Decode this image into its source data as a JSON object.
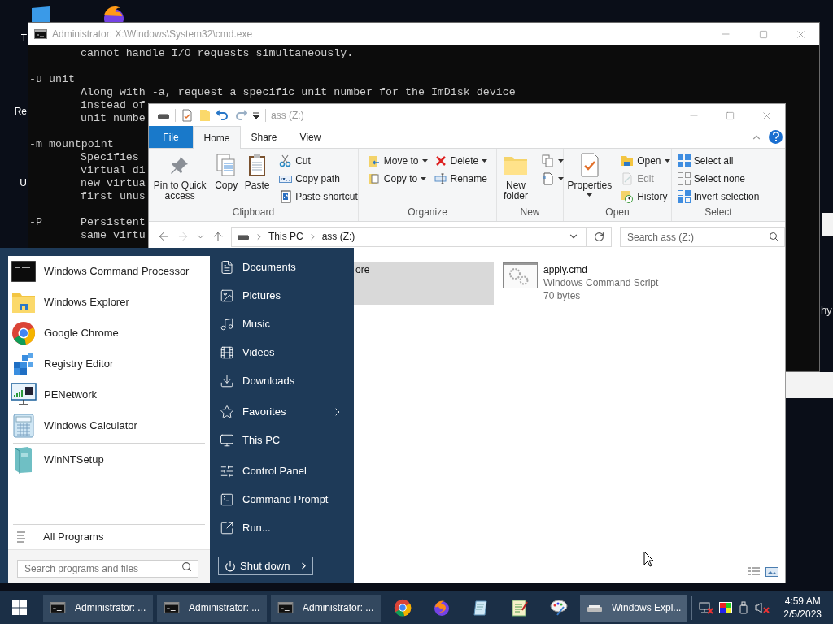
{
  "desktop": {
    "labels": [
      "T",
      "Re",
      "U"
    ]
  },
  "cmd_window": {
    "title": "Administrator: X:\\Windows\\System32\\cmd.exe",
    "blocks": [
      {
        "lines": [
          {
            "text": "cannot handle I/O requests simultaneously."
          }
        ]
      },
      {
        "lines": [
          {
            "flag": "-u unit"
          },
          {
            "text": "Along with -a, request a specific unit number for the ImDisk device"
          },
          {
            "text": "instead of"
          },
          {
            "text": "unit numbe"
          }
        ]
      },
      {
        "lines": [
          {
            "flag": "-m mountpoint"
          },
          {
            "text": "Specifies"
          },
          {
            "text": "virtual di"
          },
          {
            "text": "new virtua"
          },
          {
            "text": "first unus"
          }
        ]
      },
      {
        "lines": [
          {
            "flag": "-P",
            "text": "Persistent"
          },
          {
            "text": "same virtu"
          }
        ]
      }
    ]
  },
  "explorer": {
    "title": "ass (Z:)",
    "tabs": [
      {
        "label": "File",
        "kind": "menu",
        "selected": false
      },
      {
        "label": "Home",
        "kind": "tab",
        "selected": true
      },
      {
        "label": "Share",
        "kind": "tab",
        "selected": false
      },
      {
        "label": "View",
        "kind": "tab",
        "selected": false
      }
    ],
    "ribbon": [
      {
        "label": "Clipboard",
        "columns": [
          {
            "kind": "large",
            "items": [
              {
                "label": "Pin to Quick access",
                "dropdown": false,
                "disabled": false
              },
              {
                "label": "Copy",
                "dropdown": false,
                "disabled": false
              },
              {
                "label": "Paste",
                "dropdown": false,
                "disabled": false
              }
            ]
          },
          {
            "kind": "small",
            "items": [
              {
                "label": "Cut",
                "dropdown": false,
                "disabled": false
              },
              {
                "label": "Copy path",
                "dropdown": false,
                "disabled": false
              },
              {
                "label": "Paste shortcut",
                "dropdown": false,
                "disabled": false
              }
            ]
          }
        ]
      },
      {
        "label": "Organize",
        "columns": [
          {
            "kind": "small",
            "items": [
              {
                "label": "Move to",
                "dropdown": true,
                "disabled": false
              },
              {
                "label": "Copy to",
                "dropdown": true,
                "disabled": false
              }
            ]
          },
          {
            "kind": "small",
            "items": [
              {
                "label": "Delete",
                "dropdown": true,
                "disabled": false
              },
              {
                "label": "Rename",
                "dropdown": false,
                "disabled": false
              }
            ]
          }
        ]
      },
      {
        "label": "New",
        "columns": [
          {
            "kind": "large",
            "items": [
              {
                "label": "New folder",
                "dropdown": false,
                "disabled": false
              }
            ]
          },
          {
            "kind": "small",
            "items": [
              {
                "dropdown": true,
                "disabled": false
              },
              {
                "dropdown": true,
                "disabled": false
              }
            ]
          }
        ]
      },
      {
        "label": "Open",
        "columns": [
          {
            "kind": "large",
            "items": [
              {
                "label": "Properties",
                "dropdown": true,
                "disabled": false
              }
            ]
          },
          {
            "kind": "small",
            "items": [
              {
                "label": "Open",
                "dropdown": true,
                "disabled": false
              },
              {
                "label": "Edit",
                "dropdown": false,
                "disabled": true
              },
              {
                "label": "History",
                "dropdown": false,
                "disabled": false
              }
            ]
          }
        ]
      },
      {
        "label": "Select",
        "columns": [
          {
            "kind": "small",
            "items": [
              {
                "label": "Select all",
                "dropdown": false,
                "disabled": false
              },
              {
                "label": "Select none",
                "dropdown": false,
                "disabled": false
              },
              {
                "label": "Invert selection",
                "dropdown": false,
                "disabled": false
              }
            ]
          }
        ]
      }
    ],
    "back": {
      "disabled": false
    },
    "forward": {
      "disabled": true
    },
    "path": [
      "This PC",
      "ass (Z:)"
    ],
    "search": {
      "placeholder": "Search ass (Z:)"
    },
    "files": [
      {
        "name": "ore",
        "selected": true
      },
      {
        "name": "apply.cmd",
        "type": "Windows Command Script",
        "size": "70 bytes",
        "selected": false
      }
    ]
  },
  "start_menu": {
    "programs": [
      "Windows Command Processor",
      "Windows Explorer",
      "Google Chrome",
      "Registry Editor",
      "PENetwork",
      "Windows Calculator"
    ],
    "recent": [
      "WinNTSetup"
    ],
    "all_programs": "All Programs",
    "search": {
      "placeholder": "Search programs and files"
    },
    "places": [
      [
        {
          "label": "Documents",
          "submenu": false
        },
        {
          "label": "Pictures",
          "submenu": false
        },
        {
          "label": "Music",
          "submenu": false
        },
        {
          "label": "Videos",
          "submenu": false
        },
        {
          "label": "Downloads",
          "submenu": false
        }
      ],
      [
        {
          "label": "Favorites",
          "submenu": true
        },
        {
          "label": "This PC",
          "submenu": false
        }
      ],
      [
        {
          "label": "Control Panel",
          "submenu": false
        },
        {
          "label": "Command Prompt",
          "submenu": false
        },
        {
          "label": "Run...",
          "submenu": false
        }
      ]
    ],
    "shutdown": "Shut down"
  },
  "taskbar": {
    "tasks": [
      {
        "kind": "window",
        "label": "Administrator: ...",
        "active": false
      },
      {
        "kind": "window",
        "label": "Administrator: ...",
        "active": false
      },
      {
        "kind": "window",
        "label": "Administrator: ...",
        "active": false
      },
      {
        "kind": "pinned"
      },
      {
        "kind": "pinned"
      },
      {
        "kind": "pinned"
      },
      {
        "kind": "pinned"
      },
      {
        "kind": "pinned"
      },
      {
        "kind": "window",
        "label": "Windows Expl...",
        "active": true
      }
    ],
    "clock": {
      "time": "4:59 AM",
      "date": "2/5/2023"
    }
  },
  "fragments": {
    "text": "hy"
  }
}
